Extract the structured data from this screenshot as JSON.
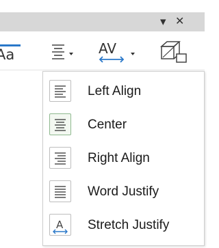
{
  "toolbar": {
    "font_case_text": "Aa",
    "spacing_text": "AV"
  },
  "menu": {
    "items": [
      {
        "label": "Left Align",
        "icon": "align-left-icon"
      },
      {
        "label": "Center",
        "icon": "align-center-icon",
        "selected": true
      },
      {
        "label": "Right Align",
        "icon": "align-right-icon"
      },
      {
        "label": "Word Justify",
        "icon": "justify-icon"
      },
      {
        "label": "Stretch Justify",
        "icon": "stretch-justify-icon"
      }
    ]
  },
  "colors": {
    "titlebar": "#d7d7d7",
    "accent_blue": "#2a78c9",
    "selected_border": "#8fb98f"
  }
}
